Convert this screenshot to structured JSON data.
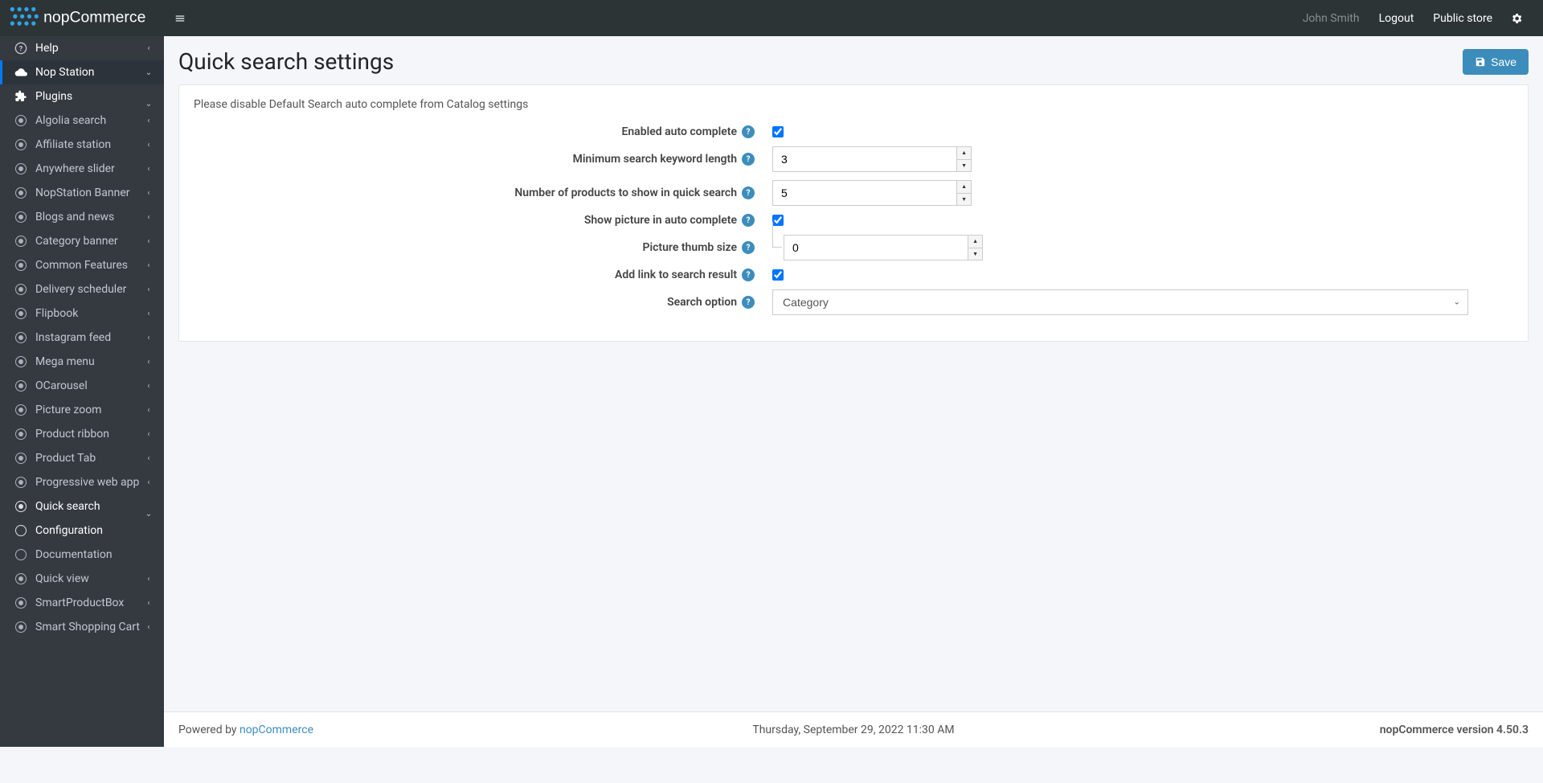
{
  "navbar": {
    "user": "John Smith",
    "logout": "Logout",
    "public_store": "Public store"
  },
  "sidebar": {
    "help": "Help",
    "nop_station": "Nop Station",
    "plugins": "Plugins",
    "items": [
      "Algolia search",
      "Affiliate station",
      "Anywhere slider",
      "NopStation Banner",
      "Blogs and news",
      "Category banner",
      "Common Features",
      "Delivery scheduler",
      "Flipbook",
      "Instagram feed",
      "Mega menu",
      "OCarousel",
      "Picture zoom",
      "Product ribbon",
      "Product Tab",
      "Progressive web app"
    ],
    "quick_search": "Quick search",
    "quick_search_children": {
      "configuration": "Configuration",
      "documentation": "Documentation"
    },
    "after_items": [
      "Quick view",
      "SmartProductBox",
      "Smart Shopping Cart"
    ]
  },
  "page": {
    "title": "Quick search settings",
    "save": "Save",
    "notice": "Please disable Default Search auto complete from Catalog settings"
  },
  "form": {
    "enabled_label": "Enabled auto complete",
    "enabled_value": true,
    "min_keyword_label": "Minimum search keyword length",
    "min_keyword_value": "3",
    "num_products_label": "Number of products to show in quick search",
    "num_products_value": "5",
    "show_picture_label": "Show picture in auto complete",
    "show_picture_value": true,
    "thumb_size_label": "Picture thumb size",
    "thumb_size_value": "0",
    "add_link_label": "Add link to search result",
    "add_link_value": true,
    "search_option_label": "Search option",
    "search_option_value": "Category"
  },
  "footer": {
    "powered_by": "Powered by ",
    "powered_link": "nopCommerce",
    "date": "Thursday, September 29, 2022 11:30 AM",
    "version": "nopCommerce version 4.50.3"
  }
}
